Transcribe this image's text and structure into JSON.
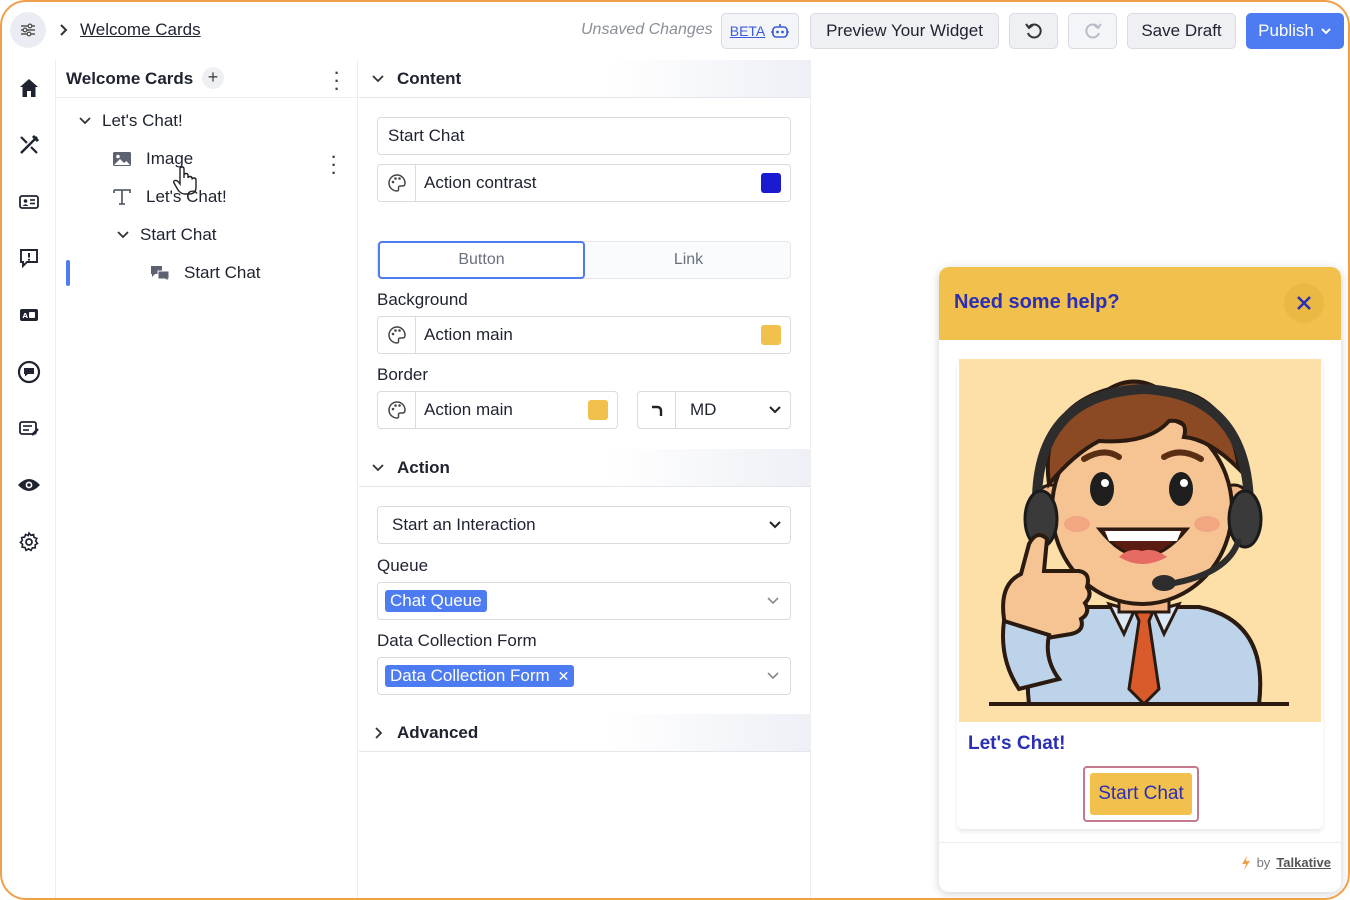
{
  "topbar": {
    "breadcrumb": "Welcome Cards",
    "status": "Unsaved Changes",
    "beta_label": "BETA",
    "preview_label": "Preview Your Widget",
    "save_label": "Save Draft",
    "publish_label": "Publish"
  },
  "rail": {
    "icons": [
      "home-icon",
      "design-tools-icon",
      "contact-card-icon",
      "alert-message-icon",
      "id-card-icon",
      "chat-bubble-icon",
      "forms-icon",
      "visibility-icon",
      "settings-icon"
    ]
  },
  "tree": {
    "title": "Welcome Cards",
    "items": [
      {
        "label": "Let's Chat!",
        "icon": "chevron-down-icon"
      },
      {
        "label": "Image",
        "icon": "image-icon"
      },
      {
        "label": "Let's Chat!",
        "icon": "text-icon"
      },
      {
        "label": "Start Chat",
        "icon": "chevron-down-icon"
      },
      {
        "label": "Start Chat",
        "icon": "chat-icon"
      }
    ]
  },
  "settings": {
    "content": {
      "heading": "Content",
      "text_value": "Start Chat",
      "text_color": {
        "label": "Action contrast",
        "color": "#1a1ad1"
      },
      "tabs": [
        "Button",
        "Link"
      ],
      "active_tab": "Button",
      "background_label": "Background",
      "background": {
        "label": "Action main",
        "color": "#f2c04c"
      },
      "border_label": "Border",
      "border": {
        "label": "Action main",
        "color": "#f2c04c"
      },
      "radius_value": "MD"
    },
    "action": {
      "heading": "Action",
      "interaction_value": "Start an Interaction",
      "queue_label": "Queue",
      "queue_value": "Chat Queue",
      "form_label": "Data Collection Form",
      "form_value": "Data Collection Form"
    },
    "advanced": {
      "heading": "Advanced"
    }
  },
  "widget": {
    "title": "Need some help?",
    "card_title": "Let's Chat!",
    "button_label": "Start Chat",
    "footer_by": "by",
    "footer_brand": "Talkative",
    "colors": {
      "header": "#f2c04c",
      "title": "#2b2fb5",
      "image_bg": "#fddfa8"
    }
  }
}
